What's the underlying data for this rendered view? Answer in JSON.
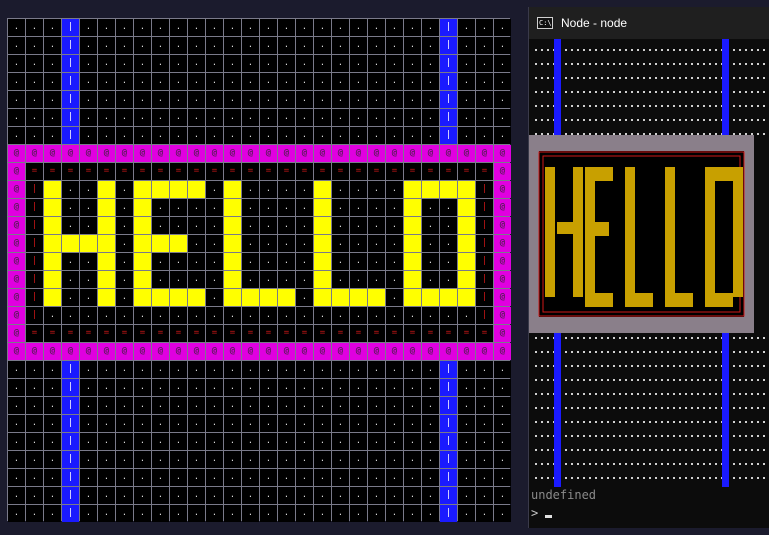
{
  "grid": {
    "rows": 28,
    "cols": 28,
    "message": "HELLO",
    "glyphs": {
      "empty": ".",
      "border": "@",
      "frame_horizontal": "=",
      "frame_vertical": "|",
      "pillar": "|"
    },
    "colors": {
      "background": "#000000",
      "empty_dot": "#d8d8d8",
      "grid_line": "#7a7a8a",
      "border_fill": "#e000e0",
      "border_glyph": "#5a1b5a",
      "frame_glyph": "#d01818",
      "letter_fill": "#ffff00",
      "pillar_fill": "#1a1aff",
      "pillar_glyph": "#ffffff"
    }
  },
  "console": {
    "title": "Node - node",
    "icon_text": "C:\\",
    "output_line": "undefined",
    "prompt": ">",
    "colors": {
      "background": "#0c0c0c",
      "titlebar": "#1f1f1f",
      "letter_fill": "#c8a000",
      "border_fill": "#8a7f8a",
      "frame_line": "#d01818",
      "pillar_fill": "#1a1aff",
      "dot": "#d0d0d0"
    }
  }
}
